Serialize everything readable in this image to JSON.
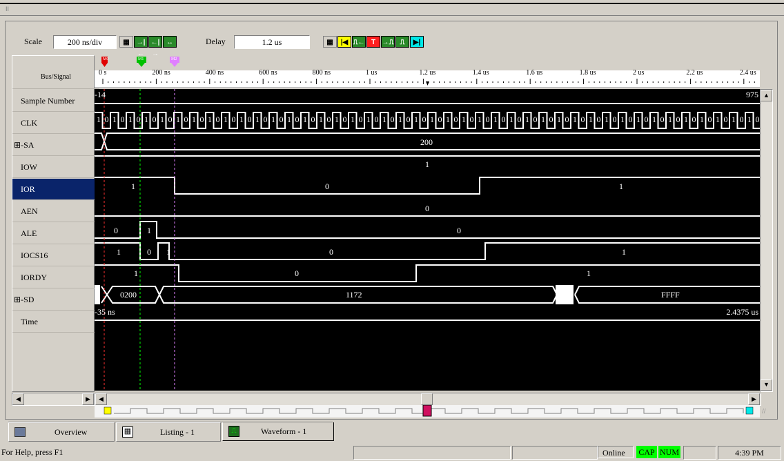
{
  "window": {
    "title_mark": "II"
  },
  "toolbar": {
    "scale_label": "Scale",
    "scale_value": "200 ns/div",
    "delay_label": "Delay",
    "delay_value": "1.2 us"
  },
  "markers": {
    "m0": "M0",
    "m1": "M1",
    "m2": "M2"
  },
  "header": {
    "bus_signal": "Bus/Signal"
  },
  "ruler": {
    "ticks": [
      "0 s",
      "200 ns",
      "400 ns",
      "600 ns",
      "800 ns",
      "1 us",
      "1.2 us",
      "1.4 us",
      "1.6 us",
      "1.8 us",
      "2 us",
      "2.2 us",
      "2.4 us"
    ]
  },
  "signals": [
    {
      "name": "Sample Number",
      "expand": ""
    },
    {
      "name": "CLK",
      "expand": ""
    },
    {
      "name": "SA",
      "expand": "⊞-"
    },
    {
      "name": "IOW",
      "expand": ""
    },
    {
      "name": "IOR",
      "expand": ""
    },
    {
      "name": "AEN",
      "expand": ""
    },
    {
      "name": "ALE",
      "expand": ""
    },
    {
      "name": "IOCS16",
      "expand": ""
    },
    {
      "name": "IORDY",
      "expand": ""
    },
    {
      "name": "SD",
      "expand": "⊞-"
    },
    {
      "name": "Time",
      "expand": ""
    }
  ],
  "wave_values": {
    "sample_start": "-14",
    "sample_end": "975",
    "sa": "200",
    "iow": "1",
    "ior": [
      "1",
      "0",
      "1"
    ],
    "aen": "0",
    "ale": [
      "0",
      "1",
      "0"
    ],
    "iocs16": [
      "1",
      "0",
      "1",
      "0",
      "1"
    ],
    "iordy": [
      "1",
      "0",
      "1"
    ],
    "sd": [
      "0200",
      "1172",
      "FFFF"
    ],
    "time_start": "-35 ns",
    "time_end": "2.4375 us"
  },
  "tabs": [
    {
      "label": "Overview"
    },
    {
      "label": "Listing - 1"
    },
    {
      "label": "Waveform - 1"
    }
  ],
  "status": {
    "help": "For Help, press F1",
    "online": "Online",
    "cap": "CAP",
    "num": "NUM",
    "time": "4:39 PM"
  },
  "colors": {
    "selection": "#0a246a",
    "wave_bg": "#000000",
    "indicator_green": "#00ff00"
  }
}
